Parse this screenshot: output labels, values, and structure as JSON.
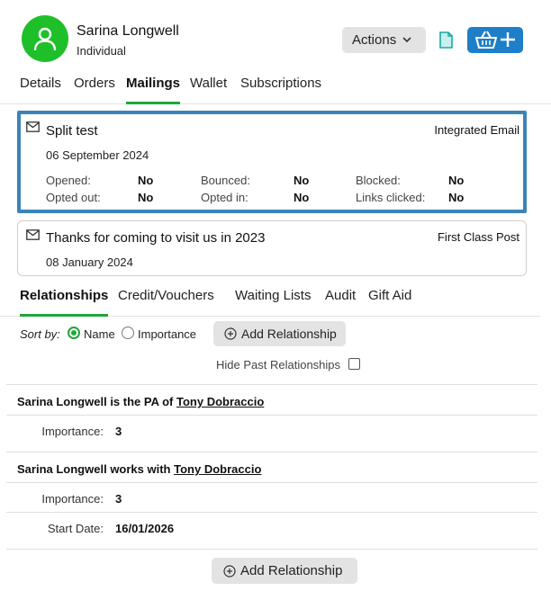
{
  "contact": {
    "name": "Sarina Longwell",
    "type": "Individual"
  },
  "header": {
    "actions_label": "Actions",
    "icons": [
      "user-icon",
      "chevron-down-icon",
      "document-icon",
      "basket-icon",
      "plus-icon"
    ],
    "accent_color": "#1e7fc8",
    "avatar_color": "#1fbf2a"
  },
  "tabs": [
    {
      "label": "Details",
      "active": false
    },
    {
      "label": "Orders",
      "active": false
    },
    {
      "label": "Mailings",
      "active": true
    },
    {
      "label": "Wallet",
      "active": false
    },
    {
      "label": "Subscriptions",
      "active": false
    }
  ],
  "mailings": [
    {
      "title": "Split test",
      "date": "06 September 2024",
      "channel": "Integrated Email",
      "stats": [
        {
          "label": "Opened:",
          "value": "No"
        },
        {
          "label": "Bounced:",
          "value": "No"
        },
        {
          "label": "Blocked:",
          "value": "No"
        },
        {
          "label": "Opted out:",
          "value": "No"
        },
        {
          "label": "Opted in:",
          "value": "No"
        },
        {
          "label": "Links clicked:",
          "value": "No"
        }
      ]
    },
    {
      "title": "Thanks for coming to visit us in 2023",
      "date": "08 January 2024",
      "channel": "First Class Post"
    }
  ],
  "subtabs": [
    {
      "label": "Relationships",
      "active": true
    },
    {
      "label": "Credit/Vouchers",
      "active": false
    },
    {
      "label": "Waiting Lists",
      "active": false
    },
    {
      "label": "Audit",
      "active": false
    },
    {
      "label": "Gift Aid",
      "active": false
    }
  ],
  "sort": {
    "label": "Sort by:",
    "options": [
      {
        "label": "Name",
        "selected": true
      },
      {
        "label": "Importance",
        "selected": false
      }
    ]
  },
  "add_relationship_label": "Add Relationship",
  "hide_past_label": "Hide Past Relationships",
  "hide_past_checked": false,
  "relationships": [
    {
      "subject": "Sarina Longwell",
      "relation": "is the PA of",
      "other": "Tony Dobraccio",
      "fields": [
        {
          "label": "Importance:",
          "value": "3"
        }
      ]
    },
    {
      "subject": "Sarina Longwell",
      "relation": "works with",
      "other": "Tony Dobraccio",
      "fields": [
        {
          "label": "Importance:",
          "value": "3"
        },
        {
          "label": "Start Date:",
          "value": "16/01/2026"
        }
      ]
    }
  ]
}
